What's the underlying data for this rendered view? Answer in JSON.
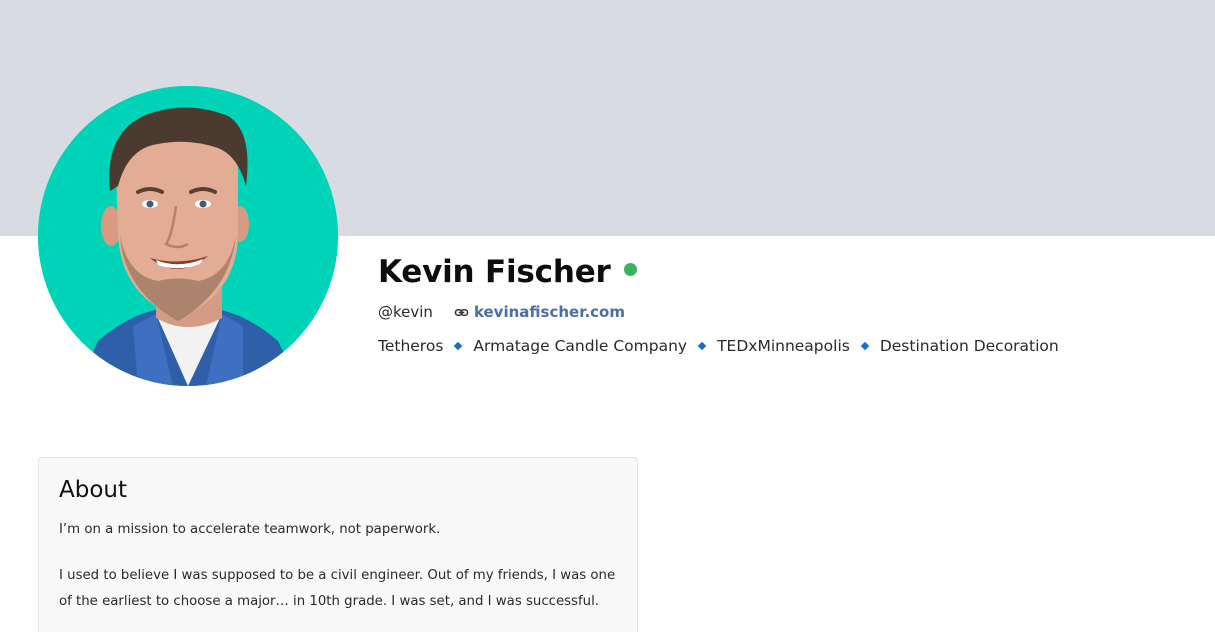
{
  "colors": {
    "cover_bg": "#d8dbe2",
    "avatar_bg": "#00d4b8",
    "presence": "#3bb35c",
    "link": "#4a6fa5",
    "separator": "#1b6fc0"
  },
  "profile": {
    "name": "Kevin Fischer",
    "status": "online",
    "handle": "@kevin",
    "website": "kevinafischer.com",
    "link_icon": "link-icon",
    "organizations": [
      "Tetheros",
      "Armatage Candle Company",
      "TEDxMinneapolis",
      "Destination Decoration"
    ]
  },
  "about": {
    "title": "About",
    "paragraphs": [
      "I’m on a mission to accelerate teamwork, not paperwork.",
      "I used to believe I was supposed to be a civil engineer. Out of my friends, I was one of the earliest to choose a major… in 10th grade. I was set, and I was successful."
    ]
  }
}
